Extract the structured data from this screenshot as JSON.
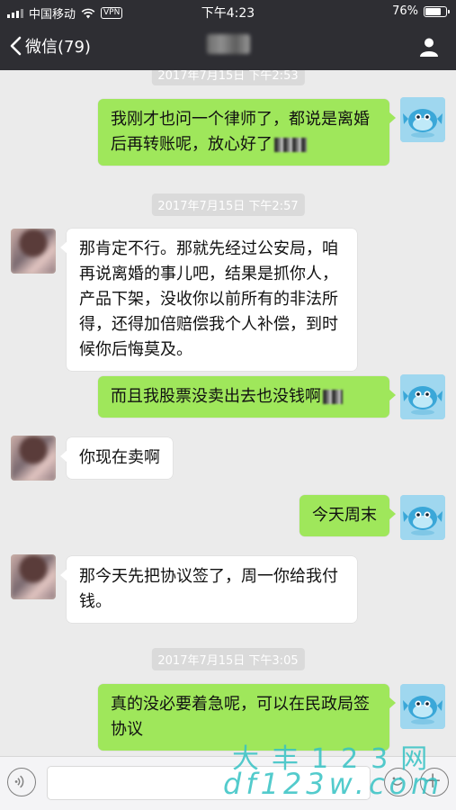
{
  "status_bar": {
    "carrier": "中国移动",
    "vpn": "VPN",
    "time": "下午4:23",
    "battery": "76%",
    "battery_level": 0.76
  },
  "nav": {
    "back_label": "微信(79)"
  },
  "messages": [
    {
      "type": "time",
      "text": "2017年7月15日 下午2:53"
    },
    {
      "type": "me",
      "text": "我刚才也问一个律师了，都说是离婚后再转账呢，放心好了"
    },
    {
      "type": "time",
      "text": "2017年7月15日 下午2:57"
    },
    {
      "type": "other",
      "text": "那肯定不行。那就先经过公安局，咱再说离婚的事儿吧，结果是抓你人，产品下架，没收你以前所有的非法所得，还得加倍赔偿我个人补偿，到时候你后悔莫及。"
    },
    {
      "type": "me",
      "text": "而且我股票没卖出去也没钱啊"
    },
    {
      "type": "other",
      "text": "你现在卖啊"
    },
    {
      "type": "me",
      "text": "今天周末"
    },
    {
      "type": "other",
      "text": "那今天先把协议签了，周一你给我付钱。"
    },
    {
      "type": "time",
      "text": "2017年7月15日 下午3:05"
    },
    {
      "type": "me",
      "text": "真的没必要着急呢，可以在民政局签协议"
    }
  ],
  "watermark": {
    "line1": "大丰123网",
    "line2": "df123w.com"
  },
  "icons": {
    "back": "chevron-left-icon",
    "profile": "person-icon",
    "voice": "voice-icon",
    "emoji": "emoji-icon",
    "plus": "plus-icon"
  },
  "colors": {
    "bar": "#2e2e33",
    "me_bubble": "#9fe75b",
    "other_bubble": "#ffffff",
    "chat_bg": "#ebebeb",
    "watermark": "#36c2c4"
  }
}
